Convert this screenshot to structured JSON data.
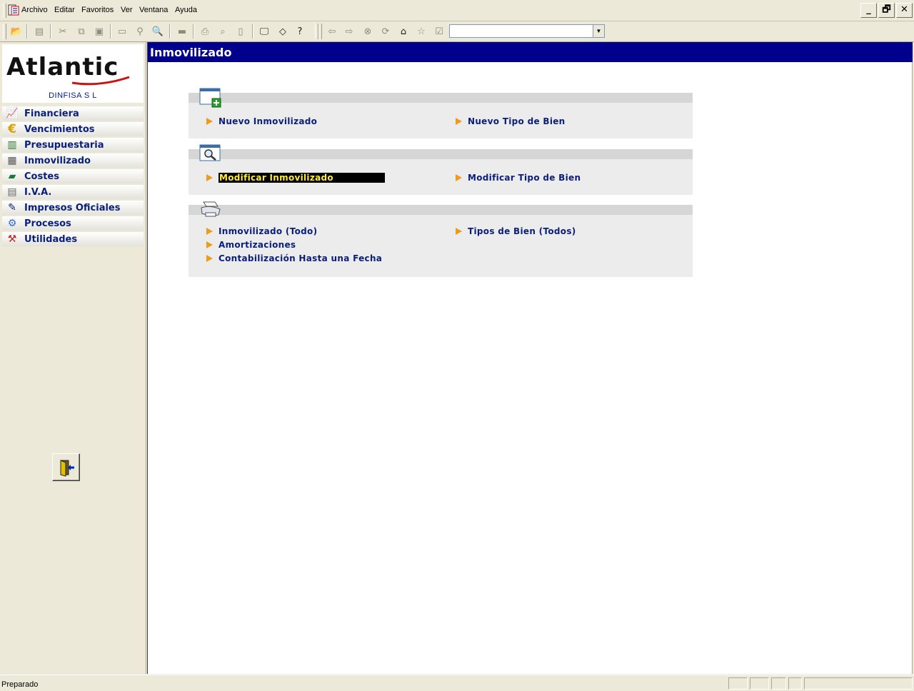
{
  "menu": {
    "items": [
      "Archivo",
      "Editar",
      "Favoritos",
      "Ver",
      "Ventana",
      "Ayuda"
    ]
  },
  "window_controls": {
    "minimize": "_",
    "restore": "🗗",
    "close": "✕"
  },
  "toolbar": {
    "address_value": ""
  },
  "sidebar": {
    "logo": "Atlantic",
    "company": "DINFISA  S L",
    "items": [
      {
        "label": "Financiera",
        "icon": "financial-chart-icon"
      },
      {
        "label": "Vencimientos",
        "icon": "euro-icon"
      },
      {
        "label": "Presupuestaria",
        "icon": "budget-icon"
      },
      {
        "label": "Inmovilizado",
        "icon": "calculator-icon"
      },
      {
        "label": "Costes",
        "icon": "costs-icon"
      },
      {
        "label": "I.V.A.",
        "icon": "document-icon"
      },
      {
        "label": "Impresos Oficiales",
        "icon": "pen-icon"
      },
      {
        "label": "Procesos",
        "icon": "gears-icon"
      },
      {
        "label": "Utilidades",
        "icon": "tools-icon"
      }
    ]
  },
  "main": {
    "title": "Inmovilizado",
    "sections": [
      {
        "icon": "new-window-icon",
        "links": [
          "Nuevo Inmovilizado",
          "Nuevo Tipo de Bien"
        ]
      },
      {
        "icon": "search-window-icon",
        "links": [
          "Modificar Inmovilizado",
          "Modificar Tipo de Bien"
        ]
      },
      {
        "icon": "printer-icon",
        "links": [
          "Inmovilizado (Todo)",
          "Tipos de Bien (Todos)",
          "Amortizaciones",
          "Contabilización Hasta una Fecha"
        ]
      }
    ],
    "selected_link": "Modificar Inmovilizado"
  },
  "status": {
    "text": "Preparado"
  },
  "colors": {
    "title_bar": "#00008c",
    "link_text": "#0a1f7a",
    "arrow": "#ef9a1a",
    "selection_text": "#ffeb3b"
  }
}
